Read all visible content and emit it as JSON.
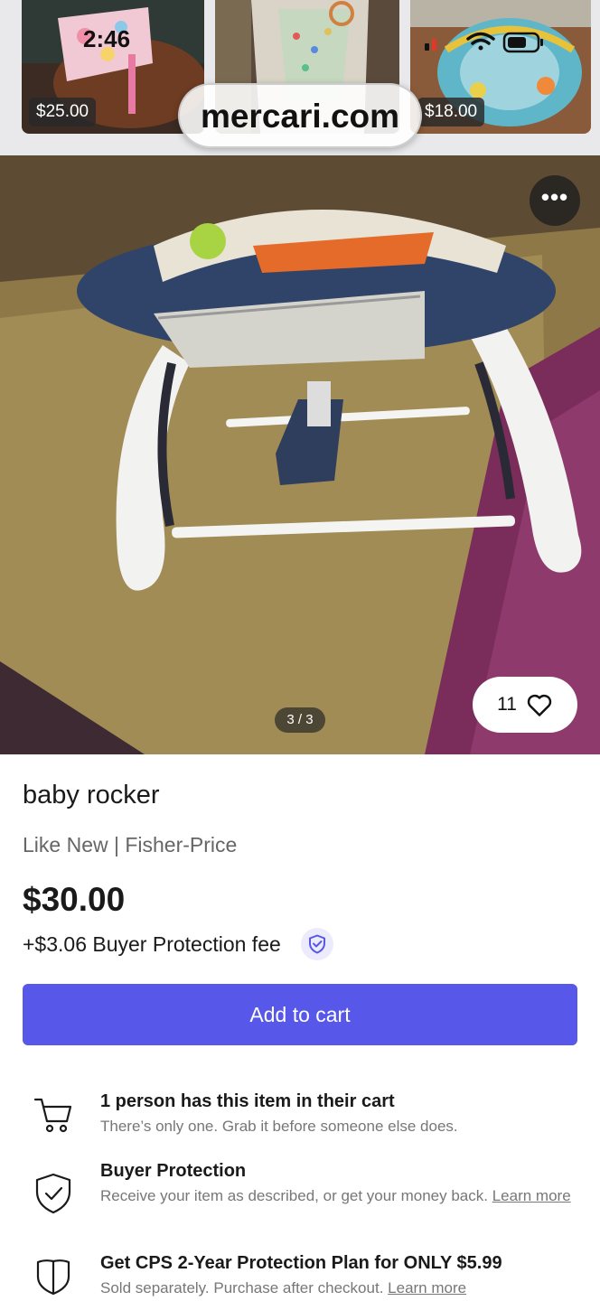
{
  "status_bar": {
    "time": "2:46"
  },
  "browser": {
    "url": "mercari.com"
  },
  "related_listings": [
    {
      "price": "$25.00"
    },
    {
      "price": ""
    },
    {
      "price": "$18.00"
    }
  ],
  "gallery": {
    "indicator": "3 / 3",
    "like_count": "11",
    "more_label": "•••"
  },
  "listing": {
    "title": "baby rocker",
    "condition_brand": "Like New | Fisher-Price",
    "price": "$30.00",
    "fee": "+$3.06 Buyer Protection fee",
    "add_to_cart_label": "Add to cart"
  },
  "info_rows": {
    "cart": {
      "title": "1 person has this item in their cart",
      "body": "There’s only one. Grab it before someone else does."
    },
    "protection": {
      "title": "Buyer Protection",
      "body": "Receive your item as described, or get your money back.",
      "link": "Learn more"
    },
    "plan": {
      "title": "Get CPS 2-Year Protection Plan for ONLY $5.99",
      "body": "Sold separately. Purchase after checkout.",
      "link": "Learn more"
    }
  },
  "colors": {
    "accent": "#5757ea",
    "text": "#1a1a1a",
    "muted": "#666666"
  },
  "icons": [
    "more-options-icon",
    "heart-icon",
    "shield-check-icon",
    "cart-icon",
    "shield-outline-icon",
    "wifi-icon",
    "signal-icon",
    "battery-icon"
  ]
}
